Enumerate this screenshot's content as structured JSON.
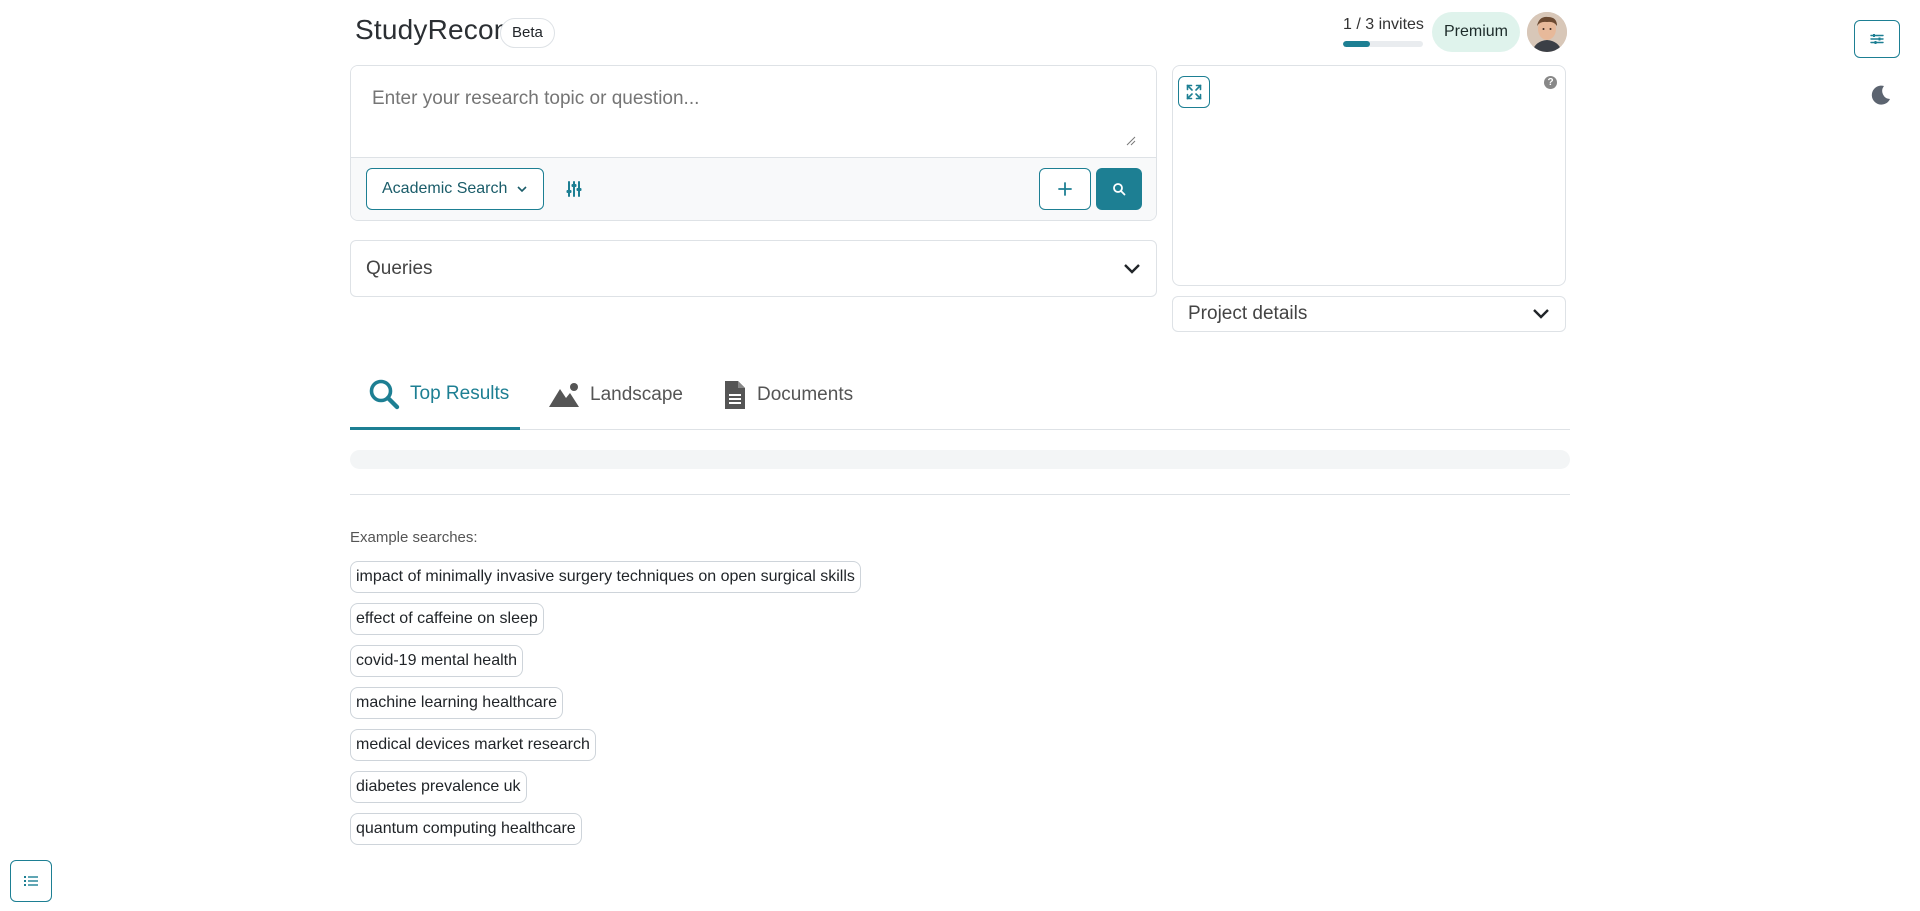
{
  "header": {
    "brand": "StudyRecon",
    "beta_badge": "Beta",
    "invites_text": "1 / 3 invites",
    "invites_used": 1,
    "invites_total": 3,
    "plan_badge": "Premium",
    "avatar_icon": "user-avatar"
  },
  "search": {
    "placeholder": "Enter your research topic or question...",
    "value": "",
    "mode_label": "Academic Search",
    "icons": {
      "filter": "sliders-icon",
      "add": "plus-icon",
      "submit": "search-icon"
    }
  },
  "queries": {
    "label": "Queries"
  },
  "side_panel": {
    "help_glyph": "?",
    "project_details_label": "Project details"
  },
  "tabs": [
    {
      "label": "Top Results",
      "icon": "search-icon",
      "active": true
    },
    {
      "label": "Landscape",
      "icon": "mountain-icon",
      "active": false
    },
    {
      "label": "Documents",
      "icon": "document-icon",
      "active": false
    }
  ],
  "examples": {
    "label": "Example searches:",
    "items": [
      "impact of minimally invasive surgery techniques on open surgical skills",
      "effect of caffeine on sleep",
      "covid-19 mental health",
      "machine learning healthcare",
      "medical devices market research",
      "diabetes prevalence uk",
      "quantum computing healthcare"
    ]
  },
  "colors": {
    "accent": "#1d7f93",
    "premium_bg": "#dff3ec",
    "border": "#dee2e6"
  }
}
